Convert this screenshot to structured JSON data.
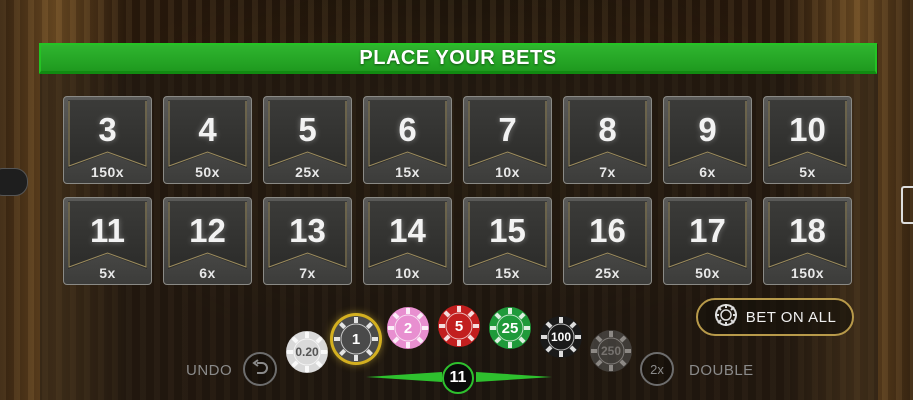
{
  "header": {
    "title": "PLACE YOUR BETS"
  },
  "tiles": [
    {
      "number": "3",
      "multiplier": "150x"
    },
    {
      "number": "4",
      "multiplier": "50x"
    },
    {
      "number": "5",
      "multiplier": "25x"
    },
    {
      "number": "6",
      "multiplier": "15x"
    },
    {
      "number": "7",
      "multiplier": "10x"
    },
    {
      "number": "8",
      "multiplier": "7x"
    },
    {
      "number": "9",
      "multiplier": "6x"
    },
    {
      "number": "10",
      "multiplier": "5x"
    },
    {
      "number": "11",
      "multiplier": "5x"
    },
    {
      "number": "12",
      "multiplier": "6x"
    },
    {
      "number": "13",
      "multiplier": "7x"
    },
    {
      "number": "14",
      "multiplier": "10x"
    },
    {
      "number": "15",
      "multiplier": "15x"
    },
    {
      "number": "16",
      "multiplier": "25x"
    },
    {
      "number": "17",
      "multiplier": "50x"
    },
    {
      "number": "18",
      "multiplier": "150x"
    }
  ],
  "bet_all": {
    "label": "BET ON ALL"
  },
  "controls": {
    "undo_label": "UNDO",
    "double_label": "DOUBLE",
    "double_icon_text": "2x",
    "selected_number": "11"
  },
  "chips": [
    {
      "value": "0.20",
      "color": "#d9d9d9",
      "text_color": "#555555"
    },
    {
      "value": "1",
      "color": "#4a4a4a",
      "text_color": "#ffffff",
      "selected": true
    },
    {
      "value": "2",
      "color": "#e88fd0",
      "text_color": "#ffffff"
    },
    {
      "value": "5",
      "color": "#c21f1f",
      "text_color": "#ffffff"
    },
    {
      "value": "25",
      "color": "#1f9a3a",
      "text_color": "#ffffff"
    },
    {
      "value": "100",
      "color": "#1a1a1a",
      "text_color": "#ffffff"
    },
    {
      "value": "250",
      "color": "#5a5a5a",
      "text_color": "#bbbbbb",
      "disabled": true
    }
  ],
  "colors": {
    "accent_green": "#2fb52f",
    "gold_border": "#b89a4a"
  }
}
